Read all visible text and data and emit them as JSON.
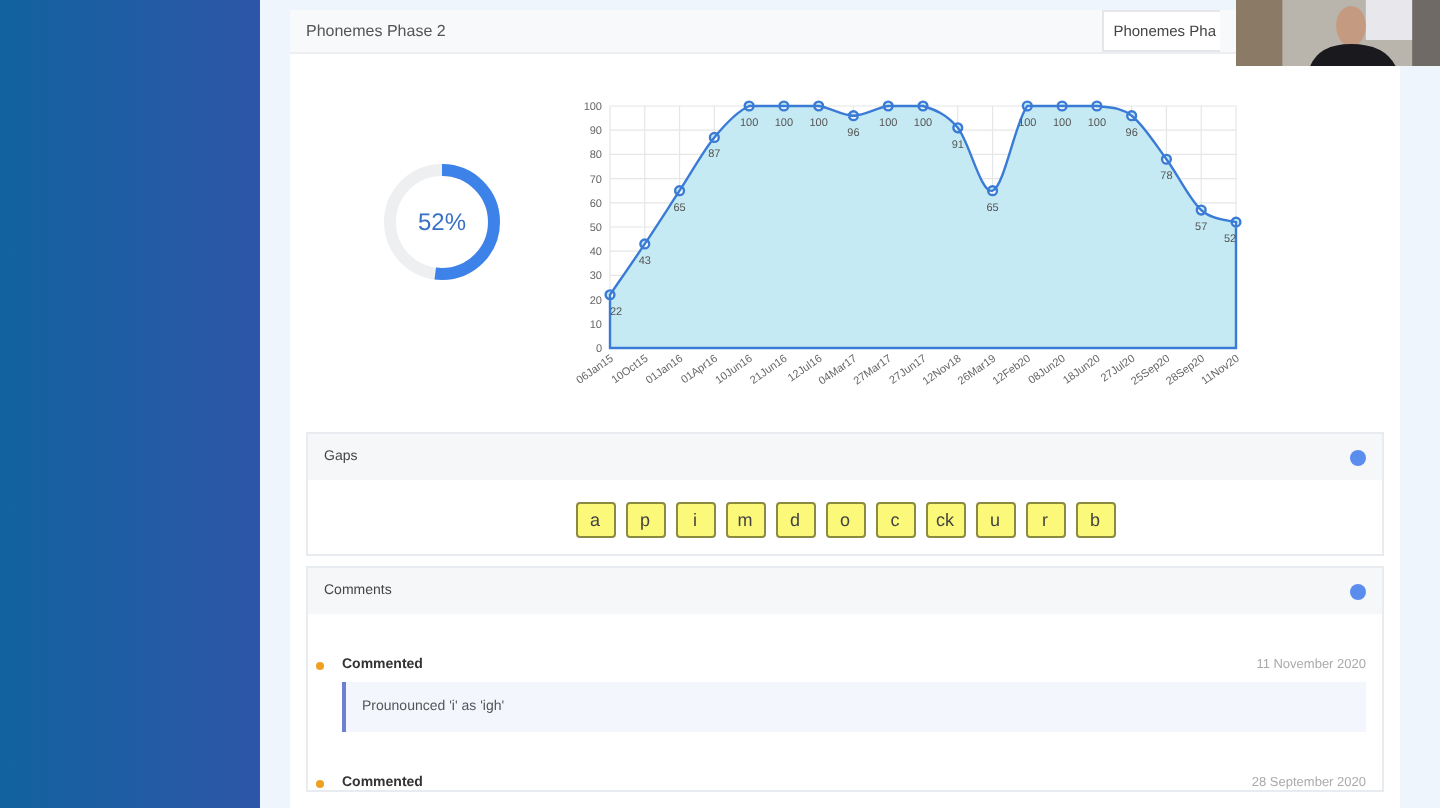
{
  "card": {
    "title": "Phonemes Phase 2",
    "tab": "Phonemes Pha"
  },
  "progress": {
    "label": "52%",
    "level": 0.52
  },
  "chart_data": {
    "type": "area",
    "categories": [
      "06Jan15",
      "10Oct15",
      "01Jan16",
      "01Apr16",
      "10Jun16",
      "21Jun16",
      "12Jul16",
      "04Mar17",
      "27Mar17",
      "27Jun17",
      "12Nov18",
      "26Mar19",
      "12Feb20",
      "08Jun20",
      "18Jun20",
      "27Jul20",
      "25Sep20",
      "28Sep20",
      "11Nov20"
    ],
    "series": [
      {
        "color": "#3a7bd5",
        "values": [
          22,
          43,
          65,
          87,
          100,
          100,
          100,
          96,
          100,
          100,
          91,
          65,
          100,
          100,
          100,
          96,
          78,
          57,
          52
        ]
      }
    ],
    "ylim": [
      0,
      100
    ],
    "yticks": [
      0,
      10,
      20,
      30,
      40,
      50,
      60,
      70,
      80,
      90,
      100
    ],
    "data_labels": true,
    "grid": true
  },
  "gaps": {
    "title": "Gaps",
    "color": "#5b8def",
    "letters": [
      "a",
      "p",
      "i",
      "m",
      "d",
      "o",
      "c",
      "ck",
      "u",
      "r",
      "b"
    ]
  },
  "comments": {
    "title": "Comments",
    "color": "#5b8def",
    "items": [
      {
        "title": "Commented",
        "date": "11 November 2020",
        "text": "Prounounced 'i' as 'igh'",
        "color": "#f0a020"
      },
      {
        "title": "Commented",
        "date": "28 September 2020",
        "color": "#f0a020"
      }
    ]
  }
}
